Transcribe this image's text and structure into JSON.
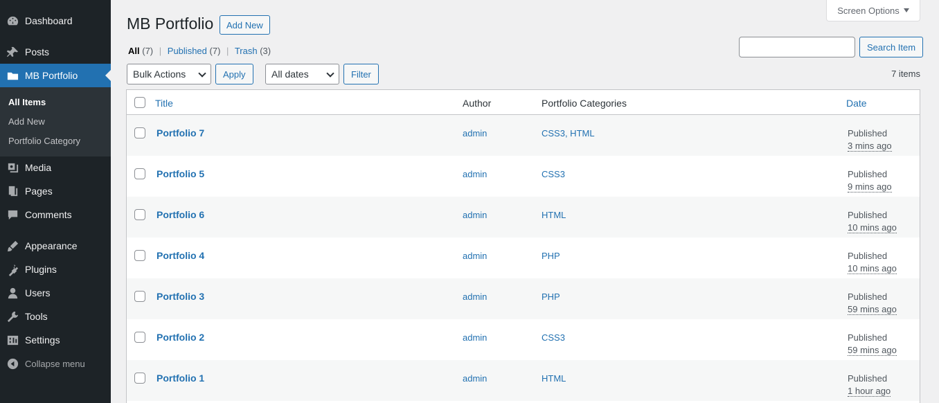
{
  "sidebar": {
    "items": [
      {
        "label": "Dashboard",
        "icon": "dashboard-icon"
      },
      {
        "label": "Posts",
        "icon": "pin-icon"
      },
      {
        "label": "MB Portfolio",
        "icon": "folder-icon"
      },
      {
        "label": "Media",
        "icon": "media-icon"
      },
      {
        "label": "Pages",
        "icon": "pages-icon"
      },
      {
        "label": "Comments",
        "icon": "comment-icon"
      },
      {
        "label": "Appearance",
        "icon": "brush-icon"
      },
      {
        "label": "Plugins",
        "icon": "plugin-icon"
      },
      {
        "label": "Users",
        "icon": "user-icon"
      },
      {
        "label": "Tools",
        "icon": "wrench-icon"
      },
      {
        "label": "Settings",
        "icon": "settings-icon"
      },
      {
        "label": "Collapse menu",
        "icon": "collapse-icon"
      }
    ],
    "submenu": [
      "All Items",
      "Add New",
      "Portfolio Category"
    ]
  },
  "header": {
    "screen_options": "Screen Options",
    "title": "MB Portfolio",
    "add_new": "Add New"
  },
  "filters": {
    "all": "All",
    "all_count": "(7)",
    "published": "Published",
    "published_count": "(7)",
    "trash": "Trash",
    "trash_count": "(3)",
    "sep": "|"
  },
  "search": {
    "button": "Search Item",
    "value": ""
  },
  "actions": {
    "bulk": "Bulk Actions",
    "apply": "Apply",
    "dates": "All dates",
    "filter": "Filter",
    "items_count": "7 items"
  },
  "table": {
    "columns": [
      "Title",
      "Author",
      "Portfolio Categories",
      "Date"
    ],
    "rows": [
      {
        "title": "Portfolio 7",
        "author": "admin",
        "categories": "CSS3, HTML",
        "status": "Published",
        "when": "3 mins ago"
      },
      {
        "title": "Portfolio 5",
        "author": "admin",
        "categories": "CSS3",
        "status": "Published",
        "when": "9 mins ago"
      },
      {
        "title": "Portfolio 6",
        "author": "admin",
        "categories": "HTML",
        "status": "Published",
        "when": "10 mins ago"
      },
      {
        "title": "Portfolio 4",
        "author": "admin",
        "categories": "PHP",
        "status": "Published",
        "when": "10 mins ago"
      },
      {
        "title": "Portfolio 3",
        "author": "admin",
        "categories": "PHP",
        "status": "Published",
        "when": "59 mins ago"
      },
      {
        "title": "Portfolio 2",
        "author": "admin",
        "categories": "CSS3",
        "status": "Published",
        "when": "59 mins ago"
      },
      {
        "title": "Portfolio 1",
        "author": "admin",
        "categories": "HTML",
        "status": "Published",
        "when": "1 hour ago"
      }
    ]
  },
  "colors": {
    "accent": "#2271b1",
    "sidebar": "#1d2327",
    "submenu": "#2c3338",
    "background": "#f0f0f1"
  }
}
